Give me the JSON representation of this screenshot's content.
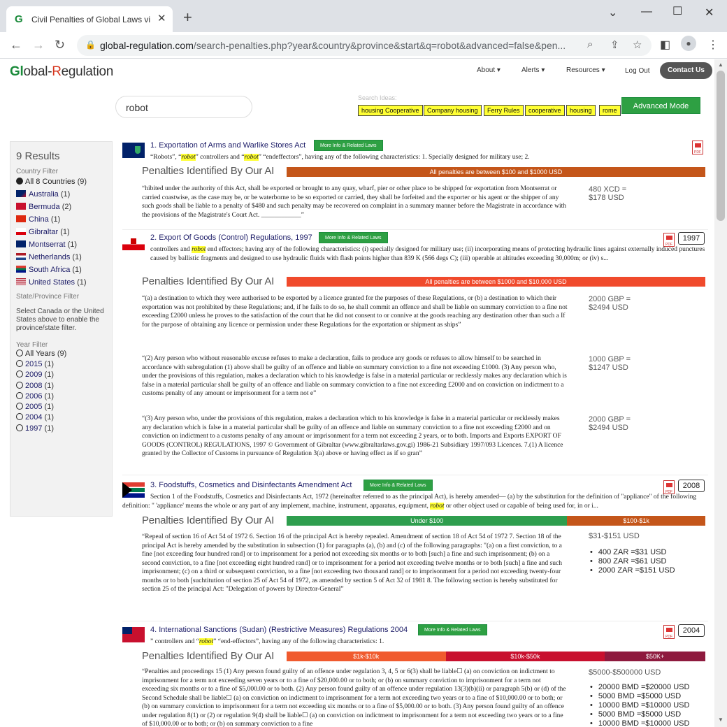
{
  "browser": {
    "tab_title": "Civil Penalties of Global Laws via",
    "url_host": "global-regulation.com",
    "url_path": "/search-penalties.php?year&country&province&start&q=robot&advanced=false&pen..."
  },
  "site": {
    "logo_g": "Gl",
    "logo_mid": "obal-",
    "logo_r": "R",
    "logo_end": "egulation",
    "nav": [
      "About",
      "Alerts",
      "Resources"
    ],
    "logout": "Log Out",
    "contact": "Contact Us"
  },
  "search": {
    "query": "robot",
    "ideas_label": "Search Ideas:",
    "ideas": [
      "housing Cooperative",
      "Company housing",
      "Ferry Rules",
      "cooperative",
      "housing",
      "rome"
    ],
    "advanced": "Advanced Mode"
  },
  "sidebar": {
    "results": "9 Results",
    "country_filter": "Country Filter",
    "all_countries": "All 8 Countries",
    "all_countries_count": "(9)",
    "countries": [
      {
        "name": "Australia",
        "count": "(1)"
      },
      {
        "name": "Bermuda",
        "count": "(2)"
      },
      {
        "name": "China",
        "count": "(1)"
      },
      {
        "name": "Gibraltar",
        "count": "(1)"
      },
      {
        "name": "Montserrat",
        "count": "(1)"
      },
      {
        "name": "Netherlands",
        "count": "(1)"
      },
      {
        "name": "South Africa",
        "count": "(1)"
      },
      {
        "name": "United States",
        "count": "(1)"
      }
    ],
    "province_filter": "State/Province Filter",
    "province_note": "Select Canada or the United States above to enable the province/state filter.",
    "year_filter": "Year Filter",
    "all_years": "All Years",
    "all_years_count": "(9)",
    "years": [
      {
        "y": "2015",
        "c": "(1)"
      },
      {
        "y": "2009",
        "c": "(1)"
      },
      {
        "y": "2008",
        "c": "(1)"
      },
      {
        "y": "2006",
        "c": "(1)"
      },
      {
        "y": "2005",
        "c": "(1)"
      },
      {
        "y": "2004",
        "c": "(1)"
      },
      {
        "y": "1997",
        "c": "(1)"
      }
    ]
  },
  "common": {
    "more_info": "More Info & Related Laws",
    "penalties_label": "Penalties Identified By Our AI",
    "pdf": "PDF"
  },
  "results": [
    {
      "title": "1. Exportation of Arms and Warlike Stores Act",
      "snip_a": "“Robots”, “",
      "snip_h1": "robot",
      "snip_b": "” controllers and “",
      "snip_h2": "robot",
      "snip_c": "” “endeffectors”, having any of the following characteristics: 1. Specially designed for military use; 2.",
      "bar": [
        "All penalties are between $100 and $1000 USD"
      ],
      "penalties": [
        {
          "text": "“hibited under the authority of this Act, shall be exported or brought to any quay, wharf, pier or other place to be shipped for exportation from Montserrat or carried coastwise, as the case may be, or be waterborne to be so exported or carried, they shall be forfeited and the exporter or his agent or the shipper of any such goods shall be liable to a penalty of $480 and such penalty may be recovered on complaint in a summary manner before the Magistrate in accordance with the provisions of the Magistrate's Court Act. ____________”",
          "amt1": "480 XCD =",
          "amt2": "$178 USD"
        }
      ]
    },
    {
      "title": "2. Export Of Goods (Control) Regulations, 1997",
      "year": "1997",
      "snip_a": "controllers and ",
      "snip_h1": "robot",
      "snip_b": " end effectors; having any of the following characteristics: (i) specially designed for military use; (ii) incorporating means of protecting hydraulic lines against externally induced punctures caused by ballistic fragments and designed to use hydraulic fluids with flash points higher than 839 K (566 degs C); (iii) operable at altitudes exceeding 30,000m; or (iv) s...",
      "bar": [
        "All penalties are between $1000 and $10,000 USD"
      ],
      "penalties": [
        {
          "text": "“(a) a destination to which they were authorised to be exported by a licence granted for the purposes of these Regulations, or (b) a destination to which their exportation was not prohibited by these Regulations; and, if he fails to do so, he shall commit an offence and shall be liable on summary conviction to a fine not exceeding £2000 unless he proves to the satisfaction of the court that he did not consent to or connive at the goods reaching any destination other than such a If for the purpose of obtaining any licence or permission under these Regulations for the exportation or shipment as ships”",
          "amt1": "2000 GBP =",
          "amt2": "$2494 USD"
        },
        {
          "text": "“(2) Any person who without reasonable excuse refuses to make a declaration, fails to produce any goods or refuses to allow himself to be searched in accordance with subregulation (1) above shall be guilty of an offence and liable on summary conviction to a fine not exceeding £1000. (3) Any person who, under the provisions of this regulation, makes a declaration which to his knowledge is false in a material particular or recklessly makes any declaration which is false in a material particular shall be guilty of an offence and liable on summary conviction to a fine not exceeding £2000 and on conviction on indictment to a customs penalty of any amount or imprisonment for a term not e”",
          "amt1": "1000 GBP =",
          "amt2": "$1247 USD"
        },
        {
          "text": "“(3) Any person who, under the provisions of this regulation, makes a declaration which to his knowledge is false in a material particular or recklessly makes any declaration which is false in a material particular shall be guilty of an offence and liable on summary conviction to a fine not exceeding £2000 and on conviction on indictment to a customs penalty of any amount or imprisonment for a term not exceeding 2 years, or to both. Imports and Exports EXPORT OF GOODS (CONTROL) REGULATIONS, 1997 © Government of Gibraltar (www.gibraltarlaws.gov.gi) 1986-21 Subsidiary 1997/093 Licences. 7.(1) A licence granted by the Collector of Customs in pursuance of Regulation 3(a) above or having effect as if so gran”",
          "amt1": "2000 GBP =",
          "amt2": "$2494 USD"
        }
      ]
    },
    {
      "title": "3. Foodstuffs, Cosmetics and Disinfectants Amendment Act",
      "year": "2008",
      "snip_a": "Section 1 of the Foodstuffs, Cosmetics and Disinfectants Act, 1972 (hereinafter referred to as the principal Act), is hereby amended— (a) by the substitution for the definition of \"appliance\" of the following definition: \" 'appliance' means the whole or any part of any implement, machine, instrument, apparatus, equipment, ",
      "snip_h1": "robot",
      "snip_b": " or other object used or capable of being used for, in or i...",
      "bar": [
        "Under $100",
        "$100-$1k"
      ],
      "penalties": [
        {
          "text": "“Repeal of section 16 of Act 54 of 1972 6. Section 16 of the principal Act is hereby repealed. Amendment of section 18 of Act 54 of 1972 7. Section 18 of the principal Act is hereby amended by the substitution in subsection (1) for paragraphs (a), (b) and (c) of the following paragraphs: \"(a) on a first conviction, to a fine [not exceeding four hundred rand] or to imprisonment for a period not exceeding six months or to both [such] a fine and such imprisonment; (b) on a second conviction, to a fine [not exceeding eight hundred rand] or to imprisonment for a period not exceeding twelve months or to both [such] a fine and such imprisonment; (c) on a third or subsequent conviction, to a fine [not exceeding two thousand rand] or to imprisonment for a period not exceeding twenty-four months or to both [suchtitution of section 25 of Act 54 of 1972, as amended by section 5 of Act 32 of 1981 8. The following section is hereby substituted for section 25 of the principal Act: \"Delegation of powers by Director-General”",
          "range": "$31-$151 USD",
          "list": [
            "400 ZAR =$31 USD",
            "800 ZAR =$61 USD",
            "2000 ZAR =$151 USD"
          ]
        }
      ]
    },
    {
      "title": "4. International Sanctions (Sudan) (Restrictive Measures) Regulations 2004",
      "year": "2004",
      "snip_a": "” controllers and “",
      "snip_h1": "robot",
      "snip_b": "” “end-effectors”, having any of the following characteristics: 1.",
      "bar": [
        "$1k-$10k",
        "$10k-$50k",
        "$50K+"
      ],
      "penalties": [
        {
          "text": "“Penalties and proceedings 15 (1) Any person found guilty of an offence under regulation 3, 4, 5 or 6(3) shall be liable☐ (a) on conviction on indictment to imprisonment for a term not exceeding seven years or to a fine of $20,000.00 or to both; or (b) on summary conviction to imprisonment for a term not exceeding six months or to a fine of $5,000.00 or to both. (2) Any person found guilty of an offence under regulation 13(3)(b)(ii) or paragraph 5(b) or (d) of the Second Schedule shall be liable☐ (a) on conviction on indictment to imprisonment for a term not exceeding two years or to a fine of $10,000.00 or to both; or (b) on summary conviction to imprisonment for a term not exceeding six months or to a fine of $5,000.00 or to both. (3) Any person found guilty of an offence under regulation 8(1) or (2) or regulation 9(4) shall be liable☐ (a) on conviction on indictment to imprisonment for a term not exceeding two years or to a fine of $10,000.00 or to both; or (b) on summary conviction to a fine",
          "range": "$5000-$500000 USD",
          "list": [
            "20000 BMD =$20000 USD",
            "5000 BMD =$5000 USD",
            "10000 BMD =$10000 USD",
            "5000 BMD =$5000 USD",
            "10000 BMD =$10000 USD"
          ]
        }
      ]
    }
  ]
}
